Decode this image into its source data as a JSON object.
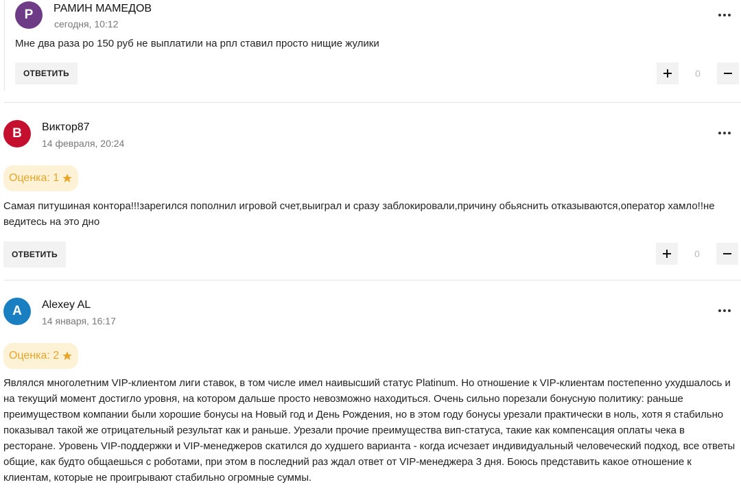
{
  "comments": [
    {
      "avatar_letter": "Р",
      "avatar_color": "#6e3b87",
      "author": "РАМИН МАМЕДОВ",
      "date": "сегодня, 10:12",
      "text": "Мне два раза ро 150 руб не выплатили на рпл ставил просто нищие жулики",
      "reply_label": "ОТВЕТИТЬ",
      "votes": "0"
    },
    {
      "avatar_letter": "В",
      "avatar_color": "#c4102e",
      "author": "Виктор87",
      "date": "14 февраля, 20:24",
      "rating_label": "Оценка: 1",
      "rating_value": 1,
      "text": "Самая питушиная контора!!!зарегился пополнил игровой счет,выиграл и сразу заблокировали,причину обьяснить отказываются,оператор хамло!!не ведитесь на это дно",
      "reply_label": "ОТВЕТИТЬ",
      "votes": "0"
    },
    {
      "avatar_letter": "A",
      "avatar_color": "#1a7fc1",
      "author": "Alexey AL",
      "date": "14 января, 16:17",
      "rating_label": "Оценка: 2",
      "rating_value": 2,
      "text": "Являлся многолетним VIP-клиентом лиги ставок, в том числе имел наивысший статус Platinum. Но отношение к VIP-клиентам постепенно ухудшалось и на текущий момент достигло уровня, на котором дальше просто невозможно находиться. Очень сильно порезали бонусную политику: раньше преимуществом компании были хорошие бонусы на Новый год и День Рождения, но в этом году бонусы урезали практически в ноль, хотя я стабильно показывал такой же отрицательный результат как и раньше. Урезали прочие преимущества вип-статуса, такие как компенсация оплаты чека в ресторане. Уровень VIP-поддержки и VIP-менеджеров скатился до худшего варианта - когда исчезает индивидуальный человеческий подход, все ответы общие, как будто общаешься с роботами, при этом в последний раз ждал ответ от VIP-менеджера 3 дня. Боюсь представить какое отношение к клиентам, которые не проигрывают стабильно огромные суммы."
    }
  ],
  "icons": {
    "more": "more-horizontal-icon",
    "plus": "plus-icon",
    "minus": "minus-icon",
    "star": "star-icon"
  },
  "colors": {
    "rating_bg": "#fdf1d6",
    "rating_text": "#e8a629",
    "button_bg": "#f2f2f2"
  }
}
